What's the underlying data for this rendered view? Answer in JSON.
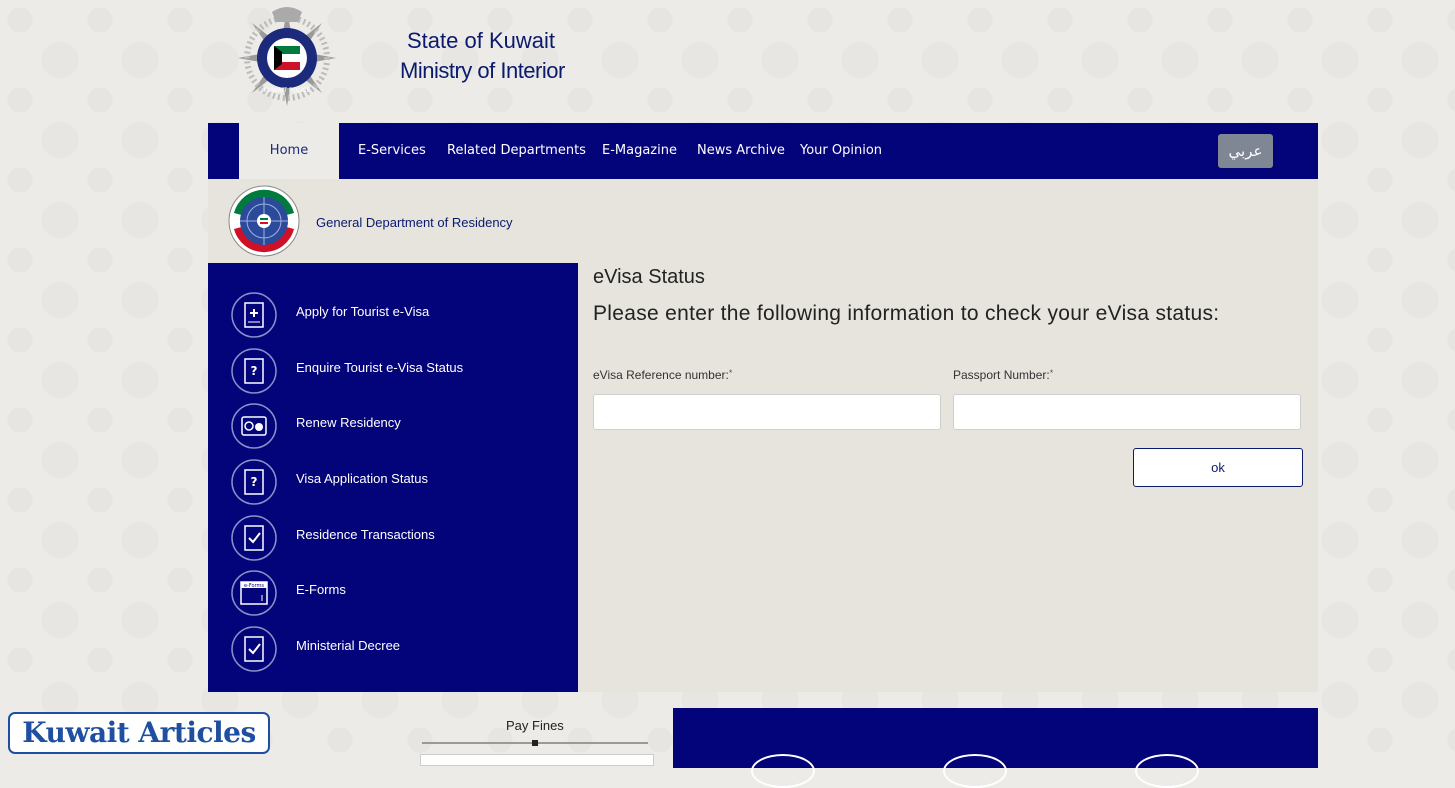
{
  "header": {
    "line1": "State of Kuwait",
    "line2": "Ministry of Interior"
  },
  "nav": {
    "items": [
      "Home",
      "E-Services",
      "Related Departments",
      "E-Magazine",
      "News Archive",
      "Your Opinion"
    ],
    "lang": "عربي"
  },
  "department": {
    "title": "General Department of Residency"
  },
  "sidebar": {
    "items": [
      {
        "label": "Apply for Tourist e-Visa",
        "icon": "apply-visa-icon"
      },
      {
        "label": "Enquire Tourist e-Visa Status",
        "icon": "enquire-status-icon"
      },
      {
        "label": "Renew Residency",
        "icon": "renew-residency-icon"
      },
      {
        "label": "Visa Application Status",
        "icon": "visa-status-icon"
      },
      {
        "label": "Residence Transactions",
        "icon": "residence-transactions-icon"
      },
      {
        "label": "E-Forms",
        "icon": "eforms-icon"
      },
      {
        "label": "Ministerial Decree",
        "icon": "ministerial-decree-icon"
      }
    ],
    "eforms_icon_text": "e-Forms"
  },
  "form": {
    "title": "eVisa Status",
    "instructions": "Please enter the following information to check your eVisa status:",
    "ref_label": "eVisa Reference number:",
    "passport_label": "Passport Number:",
    "required_mark": "*",
    "ref_value": "",
    "passport_value": "",
    "ok_label": "ok"
  },
  "footer": {
    "badge": "Kuwait Articles",
    "pay_fines": "Pay Fines"
  },
  "colors": {
    "navy": "#04047a",
    "text_navy": "#0a1a6e",
    "panel": "#e6e4dd",
    "page_bg": "#ecebe7"
  }
}
